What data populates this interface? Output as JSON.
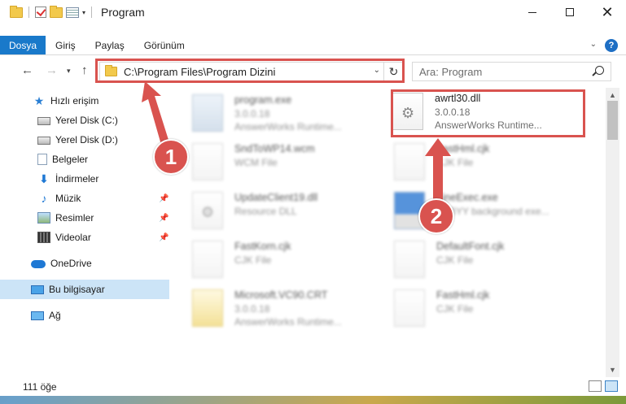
{
  "window": {
    "title": "Program"
  },
  "ribbon": {
    "tabs": [
      "Dosya",
      "Giriş",
      "Paylaş",
      "Görünüm"
    ],
    "help": "?"
  },
  "nav": {
    "address": "C:\\Program Files\\Program Dizini",
    "search_placeholder": "Ara: Program"
  },
  "sidebar": {
    "items": [
      {
        "label": "Hızlı erişim",
        "icon": "star-icon"
      },
      {
        "label": "Yerel Disk (C:)",
        "icon": "drive-icon"
      },
      {
        "label": "Yerel Disk (D:)",
        "icon": "drive-icon"
      },
      {
        "label": "Belgeler",
        "icon": "documents-icon"
      },
      {
        "label": "İndirmeler",
        "icon": "download-icon"
      },
      {
        "label": "Müzik",
        "icon": "music-icon"
      },
      {
        "label": "Resimler",
        "icon": "pictures-icon"
      },
      {
        "label": "Videolar",
        "icon": "videos-icon"
      },
      {
        "label": "OneDrive",
        "icon": "cloud-icon"
      },
      {
        "label": "Bu bilgisayar",
        "icon": "computer-icon"
      },
      {
        "label": "Ağ",
        "icon": "network-icon"
      }
    ]
  },
  "files": [
    {
      "name": "program.exe",
      "line1": "3.0.0.18",
      "line2": "AnswerWorks Runtime..."
    },
    {
      "name": "awrtl30.dll",
      "line1": "3.0.0.18",
      "line2": "AnswerWorks Runtime..."
    },
    {
      "name": "SndToWP14.wcm",
      "line1": "WCM File",
      "line2": ""
    },
    {
      "name": "FastHml.cjk",
      "line1": "CJK File",
      "line2": ""
    },
    {
      "name": "UpdateClient19.dll",
      "line1": "Resource DLL",
      "line2": ""
    },
    {
      "name": "FineExec.exe",
      "line1": "ABBYY background exe...",
      "line2": ""
    },
    {
      "name": "FastKorn.cjk",
      "line1": "CJK File",
      "line2": ""
    },
    {
      "name": "DefaultFont.cjk",
      "line1": "CJK File",
      "line2": ""
    },
    {
      "name": "Microsoft.VC90.CRT",
      "line1": "3.0.0.18",
      "line2": "AnswerWorks Runtime..."
    },
    {
      "name": "FastHml.cjk",
      "line1": "CJK File",
      "line2": ""
    }
  ],
  "markers": {
    "one": "1",
    "two": "2"
  },
  "status": {
    "count": "111 öğe"
  },
  "colors": {
    "accent": "#1979ca",
    "annotation": "#d9534f",
    "selected": "#cce4f7"
  }
}
